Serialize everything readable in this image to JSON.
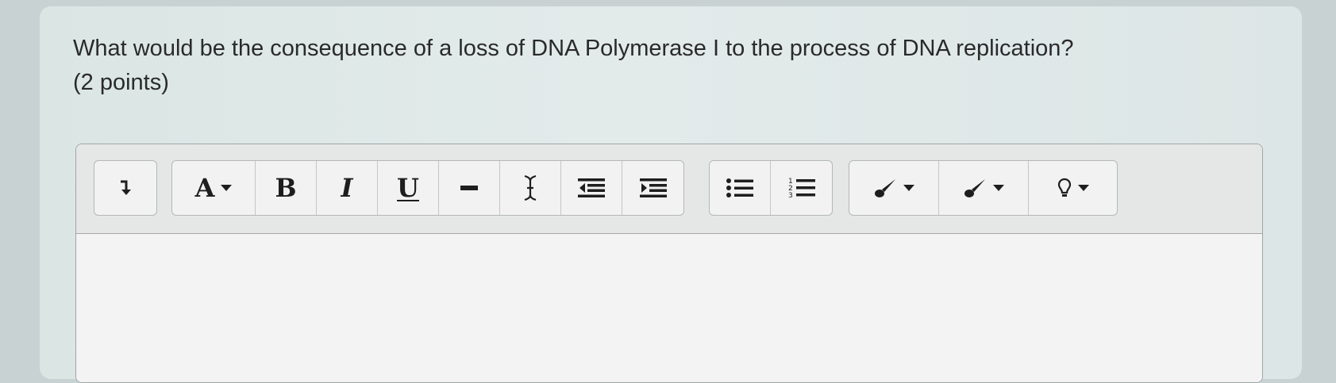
{
  "question": {
    "line1": "What would be the consequence of a loss of DNA Polymerase I to the process of DNA replication?",
    "line2": "(2 points)"
  },
  "toolbar": {
    "font_label": "A",
    "bold_label": "B",
    "italic_label": "I",
    "underline_label": "U"
  },
  "icons": [
    "insert-arrow-icon",
    "font-icon",
    "bold-icon",
    "italic-icon",
    "underline-icon",
    "strikethrough-icon",
    "text-cursor-icon",
    "outdent-icon",
    "indent-icon",
    "bullet-list-icon",
    "numbered-list-icon",
    "text-color-brush-icon",
    "highlight-brush-icon",
    "lightbulb-icon"
  ],
  "colors": {
    "text": "#2a2a2a",
    "card": "#dde6e5",
    "toolbar": "#e5e7e6"
  },
  "editor": {
    "content": ""
  }
}
